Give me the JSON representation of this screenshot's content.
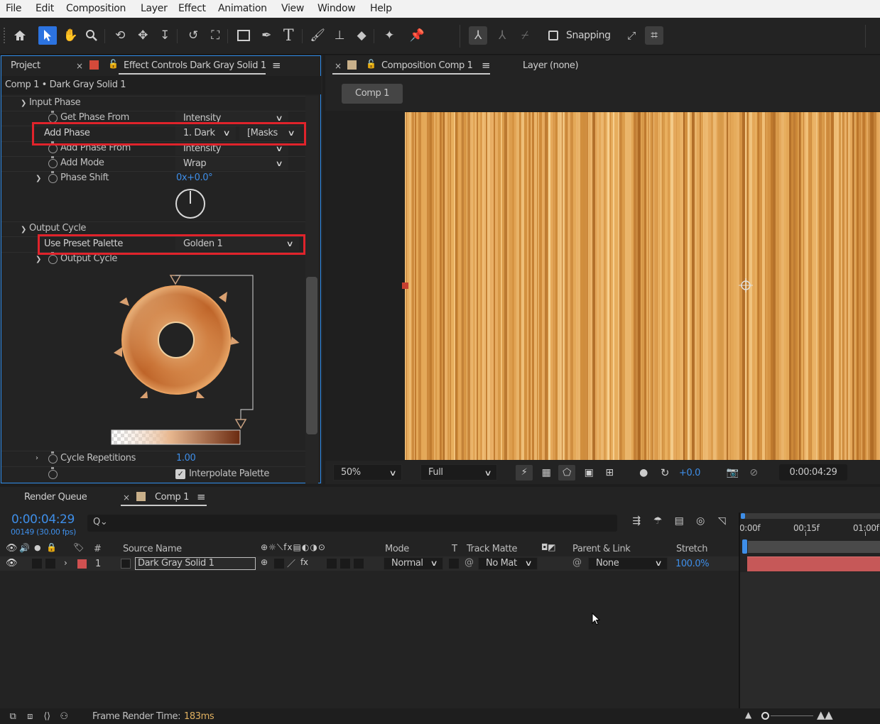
{
  "menu": [
    "File",
    "Edit",
    "Composition",
    "Layer",
    "Effect",
    "Animation",
    "View",
    "Window",
    "Help"
  ],
  "toolbar": {
    "snapping_label": "Snapping",
    "tools": [
      "home-icon",
      "selection-arrow-icon",
      "hand-icon",
      "zoom-icon",
      "orbit-camera-icon",
      "pan-camera-icon",
      "dolly-camera-icon",
      "rotate-icon",
      "pan-behind-icon",
      "rectangle-icon",
      "pen-icon",
      "type-icon",
      "brush-icon",
      "clone-stamp-icon",
      "eraser-icon",
      "roto-brush-icon",
      "puppet-pin-icon"
    ]
  },
  "effect_panel": {
    "project_tab": "Project",
    "tab_title": "Effect Controls Dark Gray Solid 1",
    "breadcrumb": "Comp 1 • Dark Gray Solid 1",
    "input_phase": {
      "group_label": "Input Phase",
      "get_phase_from_label": "Get Phase From",
      "get_phase_from_value": "Intensity",
      "add_phase_label": "Add Phase",
      "add_phase_layer": "1. Dark",
      "add_phase_masks": "[Masks",
      "add_phase_from_label": "Add Phase From",
      "add_phase_from_value": "Intensity",
      "add_mode_label": "Add Mode",
      "add_mode_value": "Wrap",
      "phase_shift_label": "Phase Shift",
      "phase_shift_value": "0x+0.0°"
    },
    "output_cycle": {
      "group_label": "Output Cycle",
      "use_preset_label": "Use Preset Palette",
      "use_preset_value": "Golden 1",
      "output_cycle_label": "Output Cycle",
      "cycle_repetitions_label": "Cycle Repetitions",
      "cycle_repetitions_value": "1.00",
      "interpolate_label": "Interpolate Palette",
      "interpolate_checked": true
    }
  },
  "comp_panel": {
    "tab_title": "Composition Comp 1",
    "layer_tab": "Layer (none)",
    "comp_button": "Comp 1",
    "zoom": "50%",
    "resolution": "Full",
    "exposure": "+0.0",
    "timecode": "0:00:04:29"
  },
  "timeline": {
    "render_queue_tab": "Render Queue",
    "comp_tab": "Comp 1",
    "current_time": "0:00:04:29",
    "frame_info": "00149 (30.00 fps)",
    "search_placeholder": "",
    "ruler": [
      "0:00f",
      "00:15f",
      "01:00f"
    ],
    "columns": {
      "number": "#",
      "source_name": "Source Name",
      "mode": "Mode",
      "t": "T",
      "track_matte": "Track Matte",
      "parent_link": "Parent & Link",
      "stretch": "Stretch"
    },
    "layer": {
      "number": "1",
      "name": "Dark Gray Solid 1",
      "mode": "Normal",
      "track_matte": "No Mat",
      "parent": "None",
      "stretch": "100.0%"
    },
    "footer_label": "Frame Render Time:",
    "footer_value": "183ms"
  },
  "colors": {
    "accent_blue": "#2d8ceb",
    "highlight_red": "#e0232b",
    "layer_label_red": "#d05050",
    "value_blue": "#3e8ee8",
    "footer_value_color": "#e0b060"
  }
}
